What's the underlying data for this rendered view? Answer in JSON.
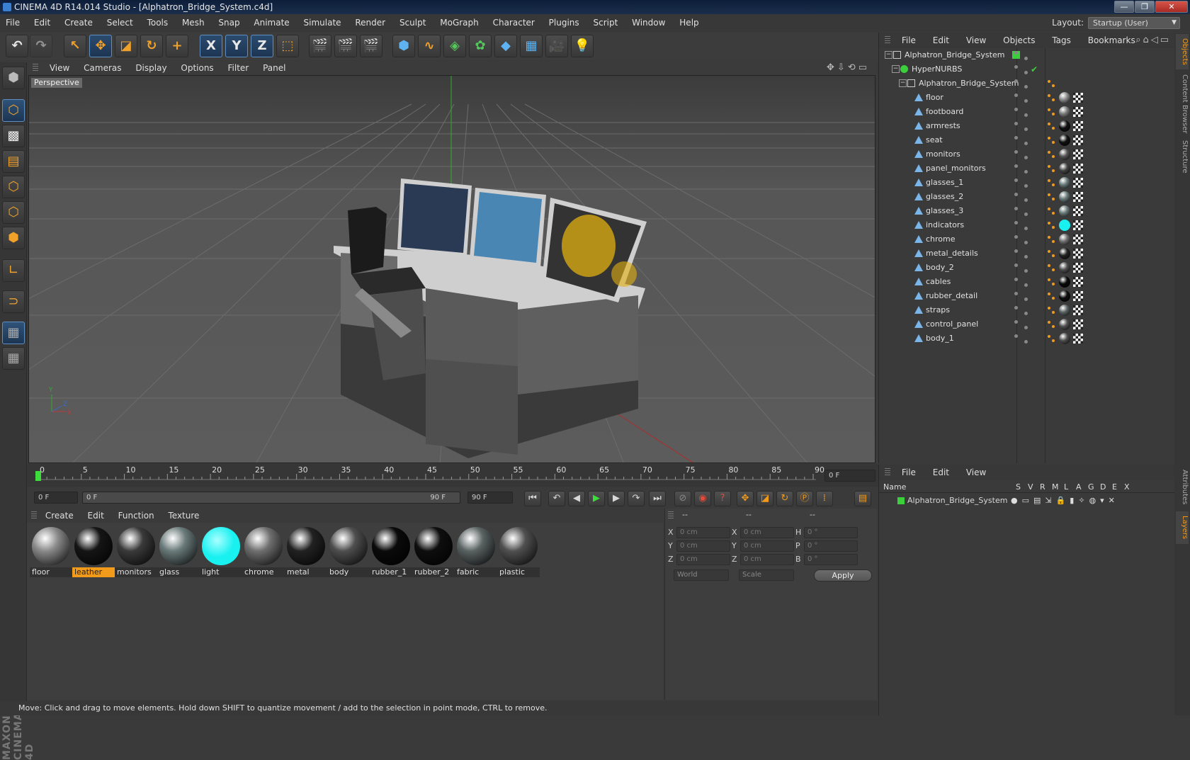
{
  "window": {
    "title": "CINEMA 4D R14.014 Studio - [Alphatron_Bridge_System.c4d]",
    "controls": [
      "—",
      "❐",
      "✕"
    ]
  },
  "menubar": {
    "items": [
      "File",
      "Edit",
      "Create",
      "Select",
      "Tools",
      "Mesh",
      "Snap",
      "Animate",
      "Simulate",
      "Render",
      "Sculpt",
      "MoGraph",
      "Character",
      "Plugins",
      "Script",
      "Window",
      "Help"
    ],
    "layout_label": "Layout:",
    "layout_value": "Startup (User)"
  },
  "toolbar": {
    "axis_x": "X",
    "axis_y": "Y",
    "axis_z": "Z"
  },
  "viewport": {
    "menu": [
      "View",
      "Cameras",
      "Display",
      "Options",
      "Filter",
      "Panel"
    ],
    "label": "Perspective",
    "axis_labels": {
      "y": "Y",
      "x": "X",
      "z": "Z"
    }
  },
  "timeline": {
    "ticks": [
      "0",
      "5",
      "10",
      "15",
      "20",
      "25",
      "30",
      "35",
      "40",
      "45",
      "50",
      "55",
      "60",
      "65",
      "70",
      "75",
      "80",
      "85",
      "90"
    ],
    "current_frame": "0 F",
    "start_field": "0 F",
    "range_start": "0 F",
    "range_end": "90 F",
    "end_field": "90 F"
  },
  "materials": {
    "menu": [
      "Create",
      "Edit",
      "Function",
      "Texture"
    ],
    "items": [
      {
        "name": "floor",
        "color": "#8a8a8a",
        "selected": false
      },
      {
        "name": "leather",
        "color": "#151515",
        "selected": true
      },
      {
        "name": "monitors",
        "color": "#3a3a3a",
        "selected": false
      },
      {
        "name": "glass",
        "color": "#6a7a7a",
        "selected": false
      },
      {
        "name": "light",
        "color": "#19f0f0",
        "selected": false
      },
      {
        "name": "chrome",
        "color": "#6f6f6f",
        "selected": false
      },
      {
        "name": "metal",
        "color": "#222222",
        "selected": false
      },
      {
        "name": "body",
        "color": "#4e4e4e",
        "selected": false
      },
      {
        "name": "rubber_1",
        "color": "#0a0a0a",
        "selected": false
      },
      {
        "name": "rubber_2",
        "color": "#0e0e0e",
        "selected": false
      },
      {
        "name": "fabric",
        "color": "#5a6262",
        "selected": false
      },
      {
        "name": "plastic",
        "color": "#505050",
        "selected": false
      }
    ]
  },
  "coords": {
    "headers": [
      "--",
      "--",
      "--"
    ],
    "rows": [
      {
        "l1": "X",
        "v1": "0 cm",
        "l2": "X",
        "v2": "0 cm",
        "l3": "H",
        "v3": "0 °"
      },
      {
        "l1": "Y",
        "v1": "0 cm",
        "l2": "Y",
        "v2": "0 cm",
        "l3": "P",
        "v3": "0 °"
      },
      {
        "l1": "Z",
        "v1": "0 cm",
        "l2": "Z",
        "v2": "0 cm",
        "l3": "B",
        "v3": "0 °"
      }
    ],
    "mode": "World",
    "scale": "Scale",
    "apply": "Apply"
  },
  "status": "Move: Click and drag to move elements. Hold down SHIFT to quantize movement / add to the selection in point mode, CTRL to remove.",
  "objects": {
    "menu": [
      "File",
      "Edit",
      "View",
      "Objects",
      "Tags",
      "Bookmarks"
    ],
    "tree": [
      {
        "name": "Alphatron_Bridge_System",
        "type": "null",
        "depth": 0,
        "mat": ""
      },
      {
        "name": "HyperNURBS",
        "type": "nurbs",
        "depth": 1,
        "mat": ""
      },
      {
        "name": "Alphatron_Bridge_System",
        "type": "null",
        "depth": 2,
        "mat": ""
      },
      {
        "name": "floor",
        "type": "mesh",
        "depth": 3,
        "mat": "#8a8a8a"
      },
      {
        "name": "footboard",
        "type": "mesh",
        "depth": 3,
        "mat": "#7a7a7a"
      },
      {
        "name": "armrests",
        "type": "mesh",
        "depth": 3,
        "mat": "#111111"
      },
      {
        "name": "seat",
        "type": "mesh",
        "depth": 3,
        "mat": "#111111"
      },
      {
        "name": "monitors",
        "type": "mesh",
        "depth": 3,
        "mat": "#555555"
      },
      {
        "name": "panel_monitors",
        "type": "mesh",
        "depth": 3,
        "mat": "#444444"
      },
      {
        "name": "glasses_1",
        "type": "mesh",
        "depth": 3,
        "mat": "#6a7a7a"
      },
      {
        "name": "glasses_2",
        "type": "mesh",
        "depth": 3,
        "mat": "#6a7a7a"
      },
      {
        "name": "glasses_3",
        "type": "mesh",
        "depth": 3,
        "mat": "#6a7a7a"
      },
      {
        "name": "indicators",
        "type": "mesh",
        "depth": 3,
        "mat": "#19f0f0"
      },
      {
        "name": "chrome",
        "type": "mesh",
        "depth": 3,
        "mat": "#6f6f6f"
      },
      {
        "name": "metal_details",
        "type": "mesh",
        "depth": 3,
        "mat": "#222222"
      },
      {
        "name": "body_2",
        "type": "mesh",
        "depth": 3,
        "mat": "#4e4e4e"
      },
      {
        "name": "cables",
        "type": "mesh",
        "depth": 3,
        "mat": "#0a0a0a"
      },
      {
        "name": "rubber_detail",
        "type": "mesh",
        "depth": 3,
        "mat": "#0e0e0e"
      },
      {
        "name": "straps",
        "type": "mesh",
        "depth": 3,
        "mat": "#5a6262"
      },
      {
        "name": "control_panel",
        "type": "mesh",
        "depth": 3,
        "mat": "#505050"
      },
      {
        "name": "body_1",
        "type": "mesh",
        "depth": 3,
        "mat": "#4e4e4e"
      }
    ]
  },
  "layers": {
    "menu": [
      "File",
      "Edit",
      "View"
    ],
    "columns": [
      "Name",
      "S",
      "V",
      "R",
      "M",
      "L",
      "A",
      "G",
      "D",
      "E",
      "X"
    ],
    "row_name": "Alphatron_Bridge_System",
    "row_color": "#3ccf3c"
  },
  "right_tabs": [
    "Objects",
    "Content Browser",
    "Structure",
    "Attributes",
    "Layers"
  ],
  "brand": "MAXON CINEMA 4D",
  "colors": {
    "accent": "#f29a1a",
    "selection_blue": "#5f8fc0"
  }
}
